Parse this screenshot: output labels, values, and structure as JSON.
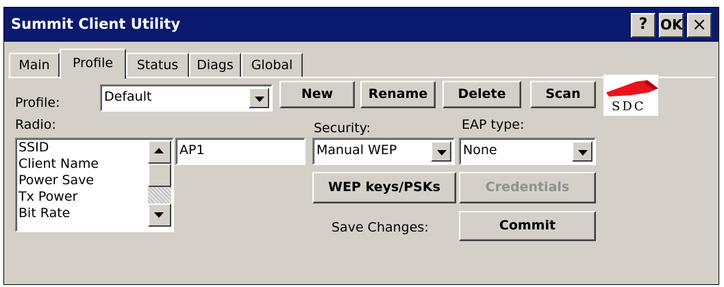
{
  "window": {
    "title": "Summit Client Utility",
    "buttons": {
      "help": "?",
      "ok": "OK",
      "close": "×"
    }
  },
  "tabs": [
    {
      "label": "Main",
      "active": false
    },
    {
      "label": "Profile",
      "active": true
    },
    {
      "label": "Status",
      "active": false
    },
    {
      "label": "Diags",
      "active": false
    },
    {
      "label": "Global",
      "active": false
    }
  ],
  "profile": {
    "label": "Profile:",
    "value": "Default",
    "buttons": {
      "new": "New",
      "rename": "Rename",
      "delete": "Delete",
      "scan": "Scan"
    },
    "logo_text": "SDC"
  },
  "radio": {
    "label": "Radio:",
    "items": [
      "SSID",
      "Client Name",
      "Power Save",
      "Tx Power",
      "Bit Rate"
    ],
    "value": "AP1"
  },
  "security": {
    "label": "Security:",
    "value": "Manual WEP"
  },
  "eap": {
    "label": "EAP type:",
    "value": "None"
  },
  "actions": {
    "wep_keys": "WEP keys/PSKs",
    "credentials": "Credentials",
    "save_label": "Save Changes:",
    "commit": "Commit"
  },
  "colors": {
    "titlebar": "#0a1a6e",
    "face": "#d4d0c8",
    "logo_red": "#e8141c"
  }
}
